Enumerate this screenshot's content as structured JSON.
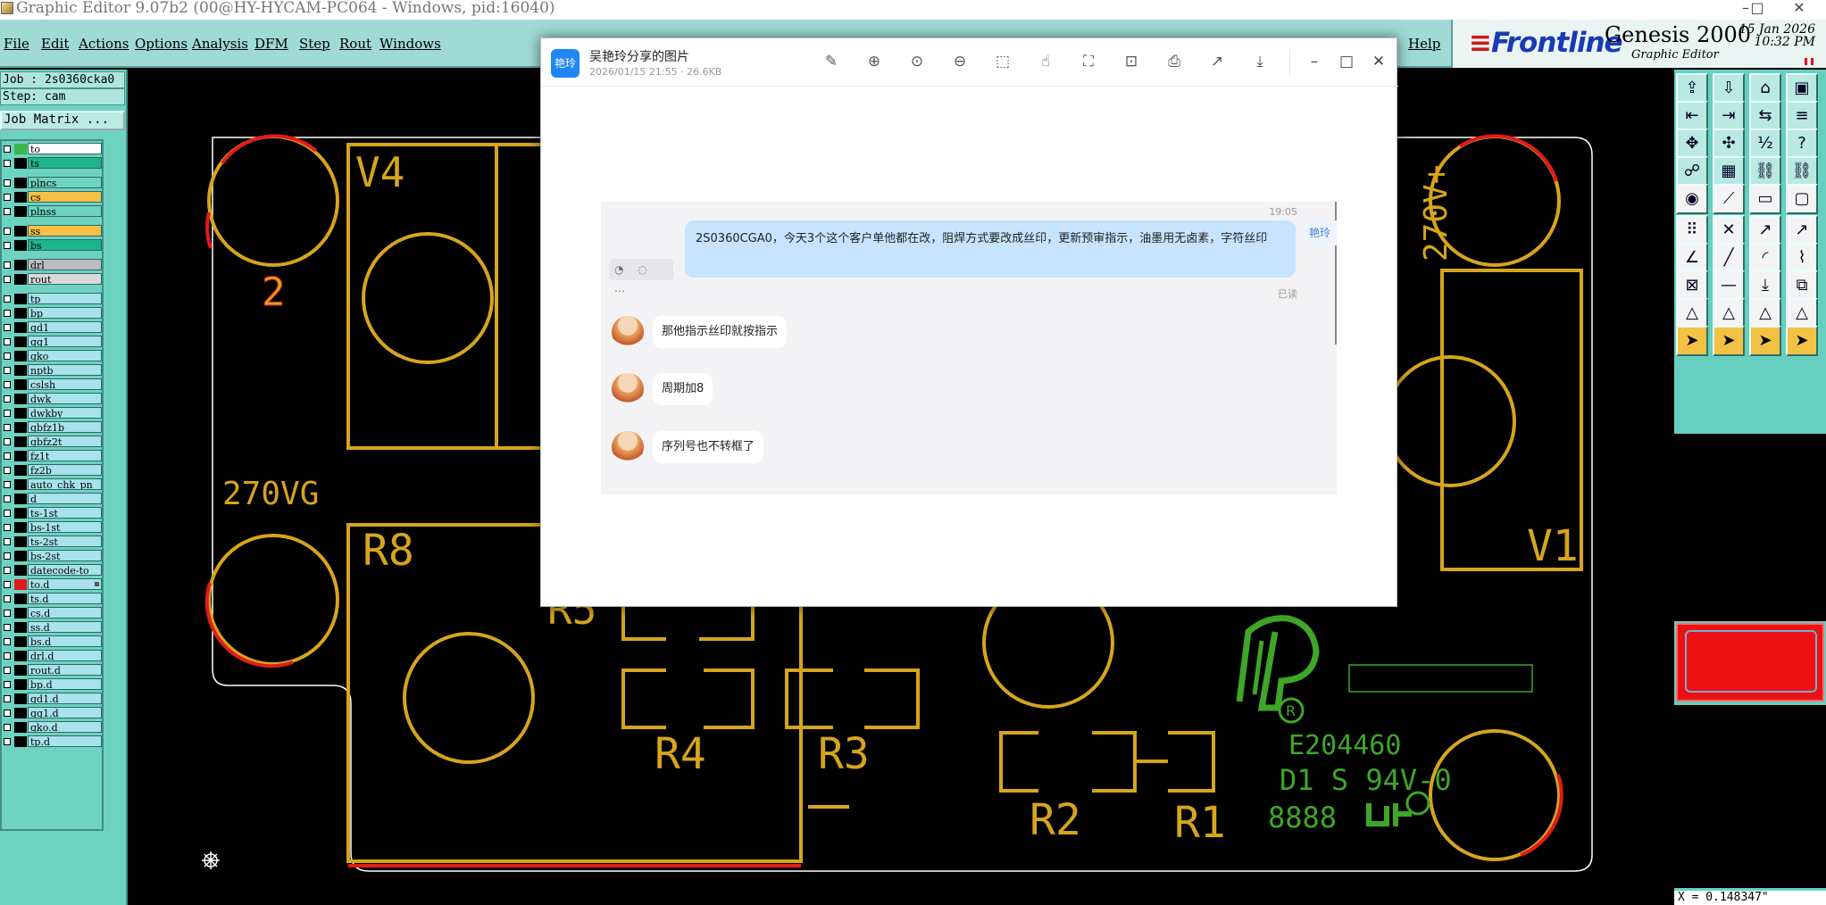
{
  "window": {
    "title": "Graphic Editor 9.07b2 (00@HY-HYCAM-PC064 - Windows, pid:16040)",
    "controls": [
      "–",
      "□",
      "✕"
    ]
  },
  "menu": {
    "items": [
      "File",
      "Edit",
      "Actions",
      "Options",
      "Analysis",
      "DFM",
      "Step",
      "Rout",
      "Windows"
    ],
    "help": "Help"
  },
  "brand": {
    "logo": "Frontline",
    "product": "Genesis 2000",
    "subtitle": "Graphic Editor",
    "date": "15 Jan 2026",
    "time": "10:32 PM"
  },
  "left_panel": {
    "job": "Job : 2s0360cka0",
    "step": "Step: cam",
    "job_matrix": "Job Matrix ..."
  },
  "layers": [
    {
      "name": "to",
      "color": "#ffffff",
      "swatch": "#39b54a"
    },
    {
      "name": "ts",
      "color": "#1fb58a",
      "swatch": "#000000"
    },
    {
      "name": "plncs",
      "color": "#6ed2c0",
      "swatch": "#000000"
    },
    {
      "name": "cs",
      "color": "#f5c043",
      "swatch": "#000000"
    },
    {
      "name": "plnss",
      "color": "#6ed2c0",
      "swatch": "#000000"
    },
    {
      "name": "ss",
      "color": "#f5c043",
      "swatch": "#000000"
    },
    {
      "name": "bs",
      "color": "#1fb58a",
      "swatch": "#000000"
    },
    {
      "name": "drl",
      "color": "#bdbdbd",
      "swatch": "#000000"
    },
    {
      "name": "rout",
      "color": "#d9d9d9",
      "swatch": "#000000"
    },
    {
      "name": "tp",
      "color": "#a8e3ec",
      "swatch": "#000000"
    },
    {
      "name": "bp",
      "color": "#a8e3ec",
      "swatch": "#000000"
    },
    {
      "name": "gd1",
      "color": "#a8e3ec",
      "swatch": "#000000"
    },
    {
      "name": "gg1",
      "color": "#a8e3ec",
      "swatch": "#000000"
    },
    {
      "name": "gko",
      "color": "#a8e3ec",
      "swatch": "#000000"
    },
    {
      "name": "nptb",
      "color": "#a8e3ec",
      "swatch": "#000000"
    },
    {
      "name": "cslsh",
      "color": "#a8e3ec",
      "swatch": "#000000"
    },
    {
      "name": "dwk",
      "color": "#a8e3ec",
      "swatch": "#000000"
    },
    {
      "name": "dwkby",
      "color": "#a8e3ec",
      "swatch": "#000000"
    },
    {
      "name": "gbfz1b",
      "color": "#a8e3ec",
      "swatch": "#000000"
    },
    {
      "name": "gbfz2t",
      "color": "#a8e3ec",
      "swatch": "#000000"
    },
    {
      "name": "fz1t",
      "color": "#a8e3ec",
      "swatch": "#000000"
    },
    {
      "name": "fz2b",
      "color": "#a8e3ec",
      "swatch": "#000000"
    },
    {
      "name": "auto_chk_pn",
      "color": "#a8e3ec",
      "swatch": "#000000"
    },
    {
      "name": "d",
      "color": "#a8e3ec",
      "swatch": "#000000"
    },
    {
      "name": "ts-1st",
      "color": "#a8e3ec",
      "swatch": "#000000"
    },
    {
      "name": "bs-1st",
      "color": "#a8e3ec",
      "swatch": "#000000"
    },
    {
      "name": "ts-2st",
      "color": "#a8e3ec",
      "swatch": "#000000"
    },
    {
      "name": "bs-2st",
      "color": "#a8e3ec",
      "swatch": "#000000"
    },
    {
      "name": "datecode-to",
      "color": "#a8e3ec",
      "swatch": "#000000"
    },
    {
      "name": "to.d",
      "color": "#a8e3ec",
      "swatch": "#e11b1b"
    },
    {
      "name": "ts.d",
      "color": "#a8e3ec",
      "swatch": "#000000"
    },
    {
      "name": "cs.d",
      "color": "#a8e3ec",
      "swatch": "#000000"
    },
    {
      "name": "ss.d",
      "color": "#a8e3ec",
      "swatch": "#000000"
    },
    {
      "name": "bs.d",
      "color": "#a8e3ec",
      "swatch": "#000000"
    },
    {
      "name": "drl.d",
      "color": "#a8e3ec",
      "swatch": "#000000"
    },
    {
      "name": "rout.d",
      "color": "#a8e3ec",
      "swatch": "#000000"
    },
    {
      "name": "bp.d",
      "color": "#a8e3ec",
      "swatch": "#000000"
    },
    {
      "name": "gd1.d",
      "color": "#a8e3ec",
      "swatch": "#000000"
    },
    {
      "name": "gg1.d",
      "color": "#a8e3ec",
      "swatch": "#000000"
    },
    {
      "name": "gko.d",
      "color": "#a8e3ec",
      "swatch": "#000000"
    },
    {
      "name": "tp.d",
      "color": "#a8e3ec",
      "swatch": "#000000"
    }
  ],
  "pcb": {
    "labels": {
      "v4": "V4",
      "two": "2",
      "vg": "270VG",
      "r8": "R8",
      "r5": "R5",
      "r4": "R4",
      "r3": "R3",
      "r2": "R2",
      "r1": "R1",
      "v1": "V1",
      "vplus": "270V+",
      "code": "E204460",
      "rating": "D1 S 94V-0",
      "date": "8888"
    },
    "colors": {
      "silk": "#d6a51c",
      "outline": "#ffffff",
      "red": "#e11b1b",
      "green": "#3fa628"
    }
  },
  "toolbox": {
    "icons": [
      "open-icon",
      "save-icon",
      "home-icon",
      "window-icon",
      "prev-icon",
      "next-icon",
      "split-icon",
      "step-icon",
      "fit-icon",
      "move-icon",
      "scale-icon",
      "help-icon",
      "snap-icon",
      "grid-icon",
      "net-icon",
      "net2-icon",
      "pad-icon",
      "line-icon",
      "text-icon",
      "frame-icon",
      "node-icon",
      "cross-icon",
      "point-icon",
      "point2-icon",
      "angle-icon",
      "diagonal-icon",
      "arc-icon",
      "bar-icon",
      "feature-icon",
      "minus-icon",
      "measure-icon",
      "group-icon",
      "tri-icon",
      "tri2-icon",
      "tri3-icon",
      "tri4-icon",
      "cursor-icon",
      "cursor2-icon",
      "cursor3-icon",
      "cursor4-icon"
    ],
    "coord": "X = 0.148347\""
  },
  "viewer": {
    "logo": "艳玲",
    "title": "吴艳玲分享的图片",
    "subtitle": "2026/01/15 21:55 · 26.6KB",
    "tool_icons": [
      "✎",
      "⊕",
      "⊙",
      "⊖",
      "⬚",
      "☝",
      "⛶",
      "⊡",
      "⎙",
      "↗",
      "⤓"
    ],
    "win_controls": [
      "–",
      "□",
      "✕"
    ]
  },
  "chat": {
    "time": "19:05",
    "own_message": "2S0360CGA0，今天3个这个客户单他都在改，阻焊方式要改成丝印，更新预审指示，油墨用无卤素，字符丝印",
    "side_tag": "艳玲",
    "read_status": "已读",
    "action_icons": "◔ ◌ ⋯",
    "messages": [
      {
        "text": "那他指示丝印就按指示"
      },
      {
        "text": "周期加8"
      },
      {
        "text": "序列号也不转框了"
      }
    ]
  }
}
